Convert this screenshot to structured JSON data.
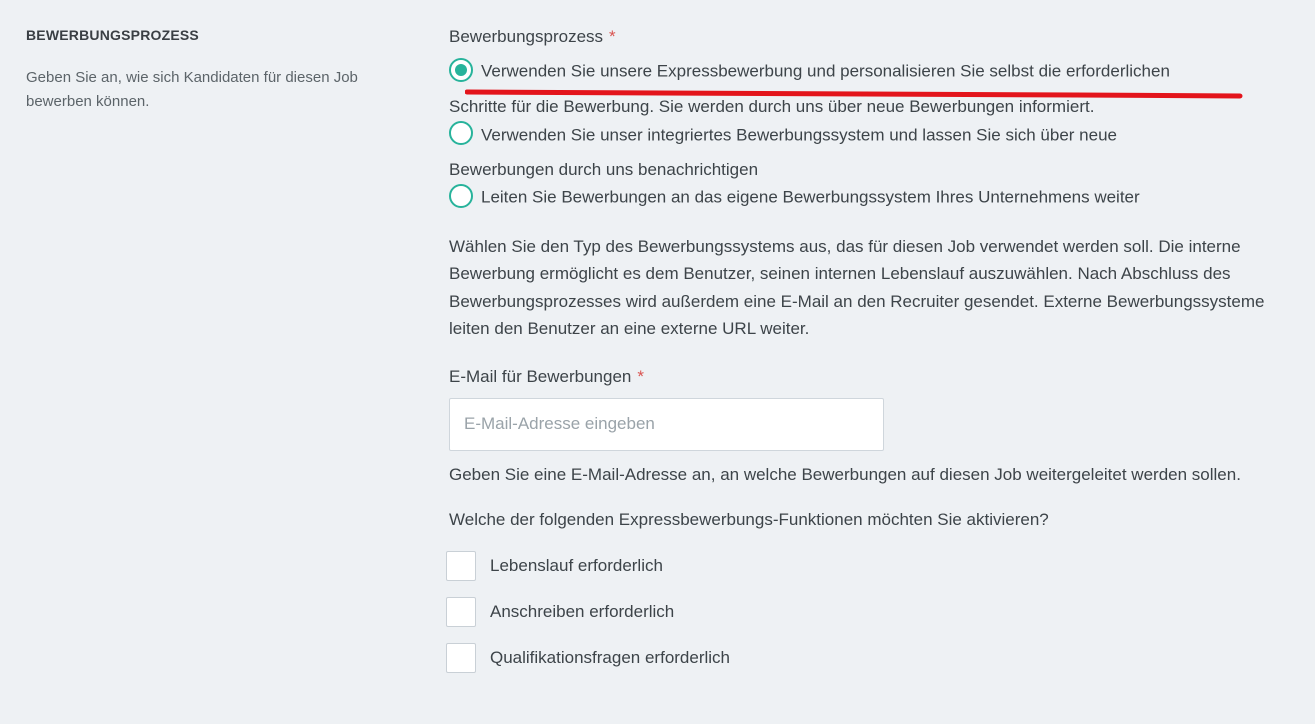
{
  "sidebar": {
    "title": "BEWERBUNGSPROZESS",
    "description": "Geben Sie an, wie sich Kandidaten für diesen Job bewerben können."
  },
  "process": {
    "label": "Bewerbungsprozess",
    "required_mark": "*",
    "options": [
      {
        "line1": "Verwenden Sie unsere Expressbewerbung und personalisieren Sie selbst die erforderlichen",
        "line2": "Schritte für die Bewerbung. Sie werden durch uns über neue Bewerbungen informiert.",
        "checked": true
      },
      {
        "line1": "Verwenden Sie unser integriertes Bewerbungssystem und lassen Sie sich über neue",
        "line2": "Bewerbungen durch uns benachrichtigen",
        "checked": false
      },
      {
        "line1": "Leiten Sie Bewerbungen an das eigene Bewerbungssystem Ihres Unternehmens weiter",
        "checked": false
      }
    ],
    "help": "Wählen Sie den Typ des Bewerbungssystems aus, das für diesen Job verwendet werden soll. Die interne Bewerbung ermöglicht es dem Benutzer, seinen internen Lebenslauf auszuwählen. Nach Abschluss des Bewerbungsprozesses wird außerdem eine E-Mail an den Recruiter gesendet. Externe Bewerbungssysteme leiten den Benutzer an eine externe URL weiter."
  },
  "email": {
    "label": "E-Mail für Bewerbungen",
    "required_mark": "*",
    "placeholder": "E-Mail-Adresse eingeben",
    "value": "",
    "help": "Geben Sie eine E-Mail-Adresse an, an welche Bewerbungen auf diesen Job weitergeleitet werden sollen."
  },
  "features": {
    "question": "Welche der folgenden Expressbewerbungs-Funktionen möchten Sie aktivieren?",
    "items": [
      {
        "label": "Lebenslauf erforderlich",
        "checked": false
      },
      {
        "label": "Anschreiben erforderlich",
        "checked": false
      },
      {
        "label": "Qualifikationsfragen erforderlich",
        "checked": false
      }
    ]
  },
  "colors": {
    "accent": "#27b39b",
    "annotation": "#e3141b",
    "background": "#eef1f4",
    "required": "#d9534f"
  }
}
